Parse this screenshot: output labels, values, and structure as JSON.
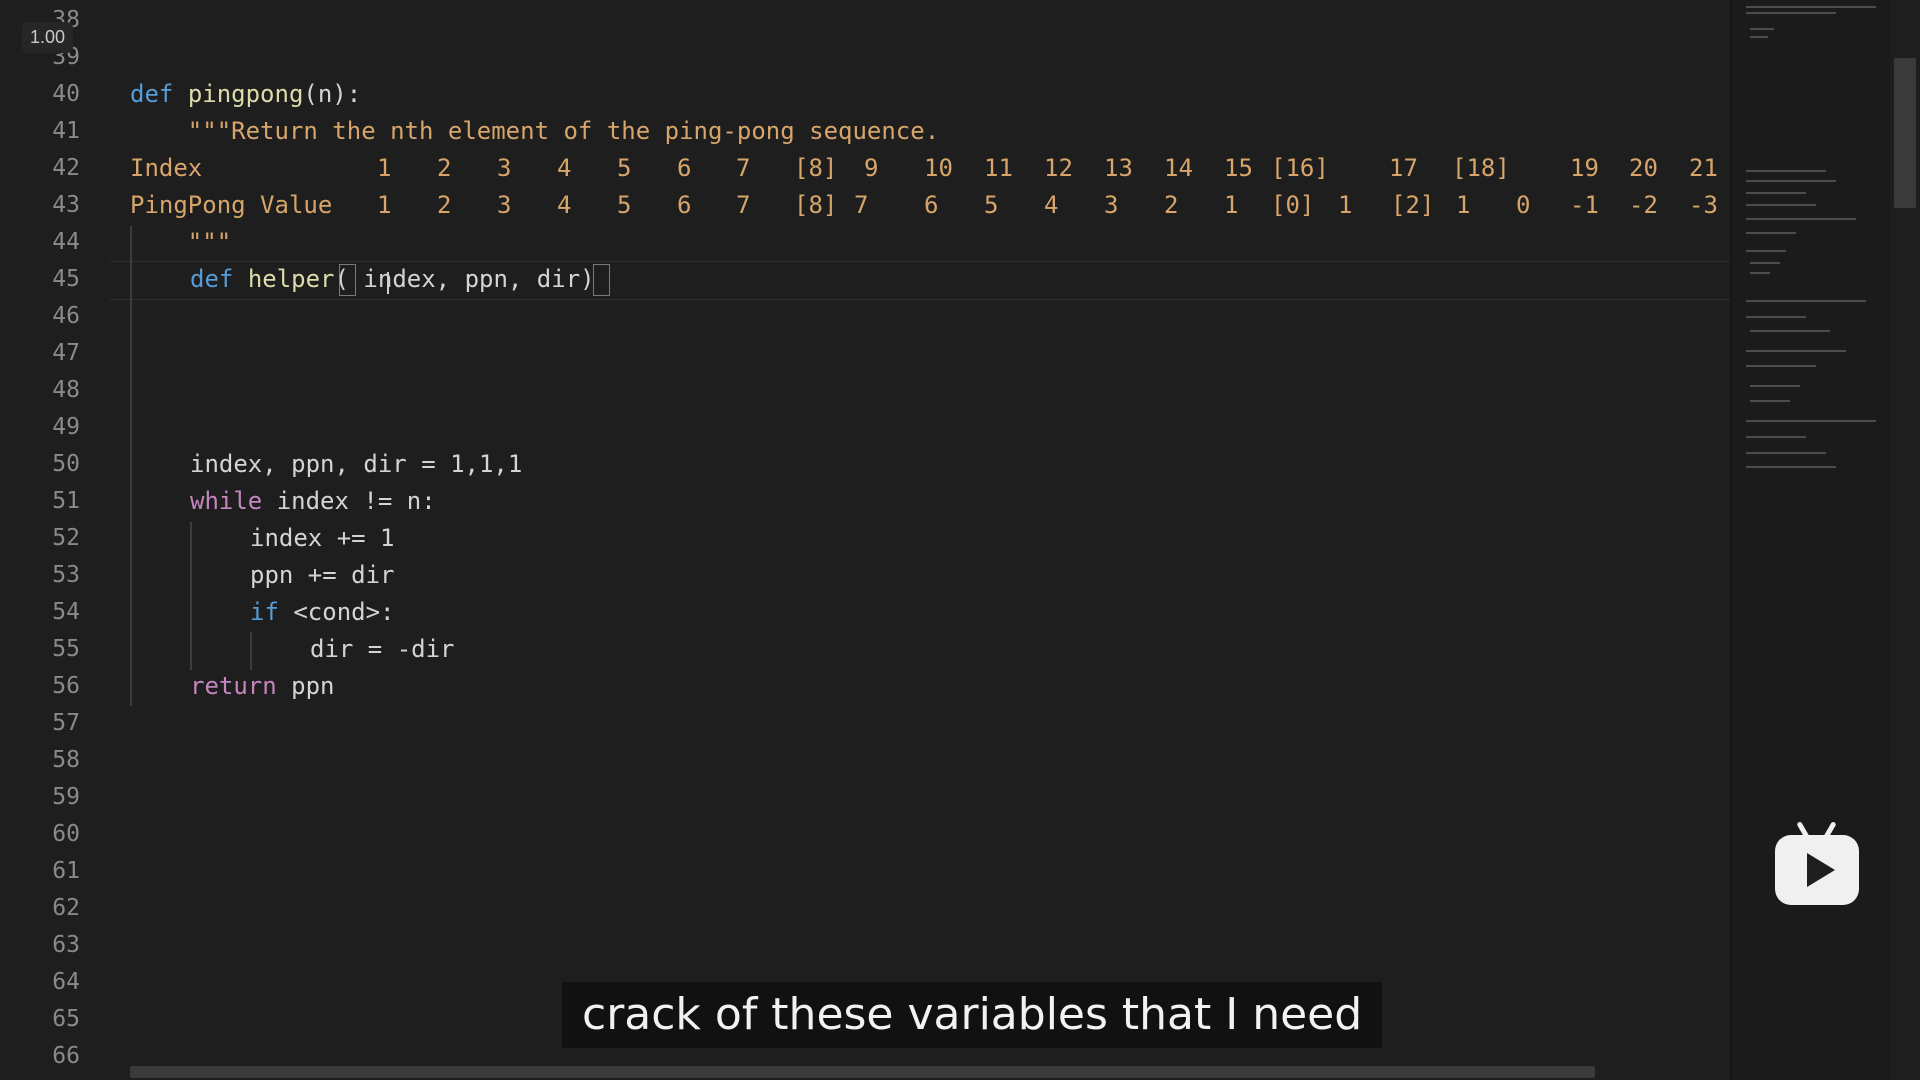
{
  "overlay": {
    "zoom_label": "1.00",
    "subtitle": "crack of these variables that I need"
  },
  "editor": {
    "line_numbers": [
      "38",
      "39",
      "40",
      "41",
      "42",
      "43",
      "44",
      "45",
      "46",
      "47",
      "48",
      "49",
      "50",
      "51",
      "52",
      "53",
      "54",
      "55",
      "56",
      "57",
      "58",
      "59",
      "60",
      "61",
      "62",
      "63",
      "64",
      "65",
      "66"
    ],
    "line40": {
      "def": "def",
      "name": "pingpong",
      "sig": "(n):"
    },
    "line41": {
      "text": "    \"\"\"Return the nth element of the ping-pong sequence."
    },
    "line42": {
      "label": "Index",
      "values": [
        "1",
        "2",
        "3",
        "4",
        "5",
        "6",
        "7",
        "[8]",
        "9",
        "10",
        "11",
        "12",
        "13",
        "14",
        "15",
        "[16]",
        "17",
        "[18]",
        "19",
        "20",
        "21"
      ]
    },
    "line43": {
      "label": "PingPong Value",
      "values": [
        "1",
        "2",
        "3",
        "4",
        "5",
        "6",
        "7",
        "[8]",
        "7",
        "6",
        "5",
        "4",
        "3",
        "2",
        "1",
        "[0]",
        "1",
        "[2]",
        "1",
        "0",
        "-1",
        "-2",
        "-3"
      ]
    },
    "line44": {
      "text": "    \"\"\""
    },
    "line45": {
      "def": "def",
      "name": "helper",
      "open": "(",
      "args": " index, ppn, dir",
      "close": ")"
    },
    "line50": {
      "text": "index, ppn, dir = 1,1,1"
    },
    "line51": {
      "kw": "while",
      "rest": " index != n:"
    },
    "line52": {
      "text": "index += 1"
    },
    "line53": {
      "text": "ppn += dir"
    },
    "line54": {
      "kw": "if",
      "rest": " <cond>:"
    },
    "line55": {
      "text": "dir = -dir"
    },
    "line56": {
      "kw": "return",
      "rest": " ppn"
    }
  }
}
